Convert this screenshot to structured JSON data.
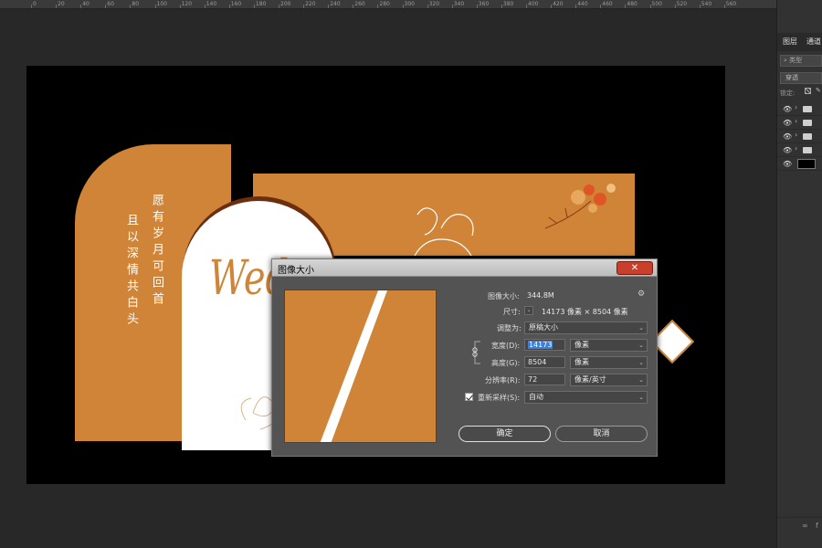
{
  "ruler": {
    "ticks": [
      "0",
      "20",
      "40",
      "60",
      "80",
      "100",
      "120",
      "140",
      "160",
      "180",
      "200",
      "220",
      "240",
      "260",
      "280",
      "300",
      "320",
      "340",
      "360",
      "380",
      "400",
      "420",
      "440",
      "460",
      "480",
      "500",
      "520",
      "540",
      "560"
    ]
  },
  "artwork": {
    "vertical_text_right": "愿有岁月可回首",
    "vertical_text_left": "且以深情共白头",
    "wedding_script": "Wed",
    "accent_color": "#d08437",
    "shadow_color": "#6b2f10"
  },
  "dialog": {
    "title": "图像大小",
    "close_icon": "close-icon",
    "image_size_label": "图像大小:",
    "image_size_value": "344.8M",
    "dimensions_label": "尺寸:",
    "dimensions_value": "14173 像素 × 8504 像素",
    "fit_to_label": "调整为:",
    "fit_to_value": "原稿大小",
    "width_label": "宽度(D):",
    "width_value": "14173",
    "width_unit": "像素",
    "height_label": "高度(G):",
    "height_value": "8504",
    "height_unit": "像素",
    "resolution_label": "分辨率(R):",
    "resolution_value": "72",
    "resolution_unit": "像素/英寸",
    "resample_label": "重新采样(S):",
    "resample_checked": true,
    "resample_value": "自动",
    "ok_label": "确定",
    "cancel_label": "取消"
  },
  "panel": {
    "tabs": [
      "图层",
      "通道"
    ],
    "search_placeholder": "类型",
    "filter_label": "穿透",
    "lock_label": "锁定:",
    "layers": [
      {
        "type": "folder",
        "visible": true
      },
      {
        "type": "folder",
        "visible": true
      },
      {
        "type": "folder",
        "visible": true
      },
      {
        "type": "folder",
        "visible": true
      },
      {
        "type": "thumbnail",
        "visible": true
      }
    ]
  }
}
